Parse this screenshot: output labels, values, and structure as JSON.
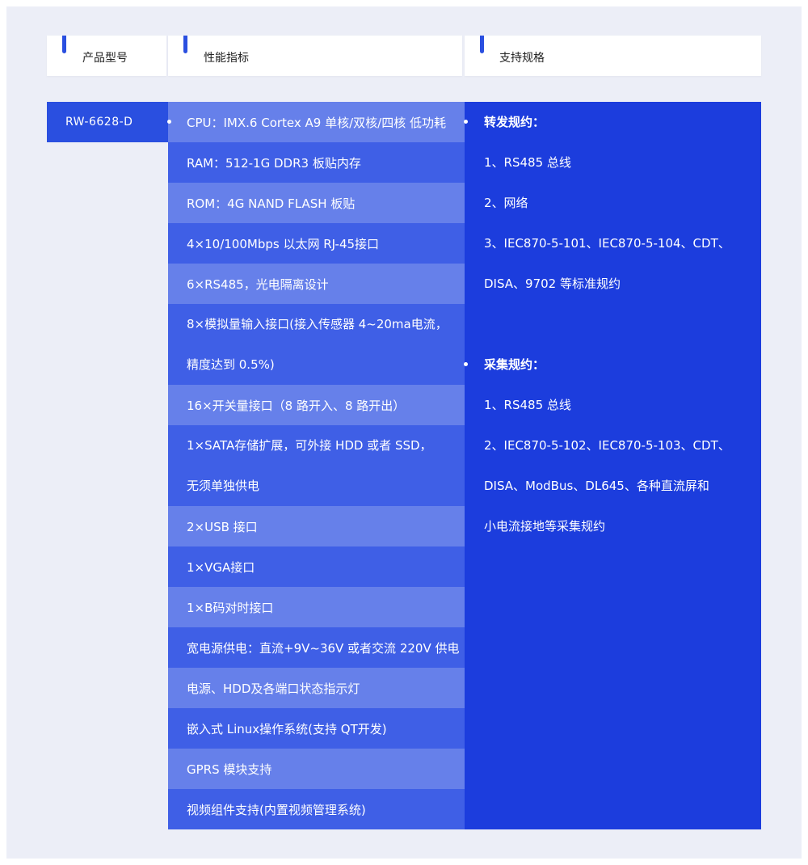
{
  "header": {
    "model_col": "产品型号",
    "performance_col": "性能指标",
    "spec_col": "支持规格"
  },
  "model": "RW-6628-D",
  "performance": [
    "CPU：IMX.6 Cortex A9 单核/双核/四核 低功耗",
    "RAM：512-1G DDR3 板贴内存",
    "ROM：4G NAND FLASH 板贴",
    "4×10/100Mbps 以太网 RJ-45接口",
    "6×RS485，光电隔离设计",
    [
      "8×模拟量输入接口(接入传感器 4~20ma电流，",
      "精度达到 0.5%)"
    ],
    "16×开关量接口（8 路开入、8 路开出）",
    [
      "1×SATA存储扩展，可外接 HDD 或者 SSD，",
      "无须单独供电"
    ],
    "2×USB 接口",
    "1×VGA接口",
    "1×B码对时接口",
    "宽电源供电：直流+9V~36V 或者交流 220V 供电",
    "电源、HDD及各端口状态指示灯",
    "嵌入式 Linux操作系统(支持 QT开发)",
    "GPRS 模块支持",
    "视频组件支持(内置视频管理系统)"
  ],
  "spec": {
    "forward_title": "转发规约：",
    "forward_lines": [
      "1、RS485 总线",
      "2、网络",
      "3、IEC870-5-101、IEC870-5-104、CDT、",
      "DISA、9702 等标准规约"
    ],
    "collect_title": "采集规约：",
    "collect_lines": [
      "1、RS485 总线",
      "2、IEC870-5-102、IEC870-5-103、CDT、",
      "DISA、ModBus、DL645、各种直流屏和",
      "小电流接地等采集规约"
    ]
  }
}
